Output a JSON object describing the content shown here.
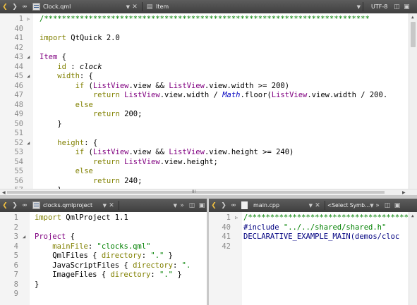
{
  "top_toolbar": {
    "file_name": "Clock.qml",
    "symbol": "Item",
    "encoding": "UTF-8"
  },
  "top_editor": {
    "lines": [
      {
        "n": "1",
        "fold": "▷",
        "tokens": [
          {
            "t": "/*************************************************************************",
            "c": "cmt"
          }
        ]
      },
      {
        "n": "40",
        "fold": "",
        "tokens": []
      },
      {
        "n": "41",
        "fold": "",
        "tokens": [
          {
            "t": "import ",
            "c": "kw"
          },
          {
            "t": "QtQuick 2.0",
            "c": ""
          }
        ]
      },
      {
        "n": "42",
        "fold": "",
        "tokens": []
      },
      {
        "n": "43",
        "fold": "◢",
        "tokens": [
          {
            "t": "Item",
            "c": "type"
          },
          {
            "t": " {",
            "c": ""
          }
        ]
      },
      {
        "n": "44",
        "fold": "",
        "tokens": [
          {
            "t": "    ",
            "c": ""
          },
          {
            "t": "id",
            "c": "kw"
          },
          {
            "t": " : ",
            "c": ""
          },
          {
            "t": "clock",
            "c": "italic"
          }
        ]
      },
      {
        "n": "45",
        "fold": "◢",
        "tokens": [
          {
            "t": "    ",
            "c": ""
          },
          {
            "t": "width",
            "c": "kw"
          },
          {
            "t": ": {",
            "c": ""
          }
        ]
      },
      {
        "n": "46",
        "fold": "",
        "tokens": [
          {
            "t": "        ",
            "c": ""
          },
          {
            "t": "if",
            "c": "kw"
          },
          {
            "t": " (",
            "c": ""
          },
          {
            "t": "ListView",
            "c": "type"
          },
          {
            "t": ".view && ",
            "c": ""
          },
          {
            "t": "ListView",
            "c": "type"
          },
          {
            "t": ".view.width >= 200)",
            "c": ""
          }
        ]
      },
      {
        "n": "47",
        "fold": "",
        "tokens": [
          {
            "t": "            ",
            "c": ""
          },
          {
            "t": "return",
            "c": "kw"
          },
          {
            "t": " ",
            "c": ""
          },
          {
            "t": "ListView",
            "c": "type"
          },
          {
            "t": ".view.width / ",
            "c": ""
          },
          {
            "t": "Math",
            "c": "blue-it"
          },
          {
            "t": ".floor(",
            "c": ""
          },
          {
            "t": "ListView",
            "c": "type"
          },
          {
            "t": ".view.width / 200.",
            "c": ""
          }
        ]
      },
      {
        "n": "48",
        "fold": "",
        "tokens": [
          {
            "t": "        ",
            "c": ""
          },
          {
            "t": "else",
            "c": "kw"
          }
        ]
      },
      {
        "n": "49",
        "fold": "",
        "tokens": [
          {
            "t": "            ",
            "c": ""
          },
          {
            "t": "return",
            "c": "kw"
          },
          {
            "t": " 200;",
            "c": ""
          }
        ]
      },
      {
        "n": "50",
        "fold": "",
        "tokens": [
          {
            "t": "    }",
            "c": ""
          }
        ]
      },
      {
        "n": "51",
        "fold": "",
        "tokens": []
      },
      {
        "n": "52",
        "fold": "◢",
        "tokens": [
          {
            "t": "    ",
            "c": ""
          },
          {
            "t": "height",
            "c": "kw"
          },
          {
            "t": ": {",
            "c": ""
          }
        ]
      },
      {
        "n": "53",
        "fold": "",
        "tokens": [
          {
            "t": "        ",
            "c": ""
          },
          {
            "t": "if",
            "c": "kw"
          },
          {
            "t": " (",
            "c": ""
          },
          {
            "t": "ListView",
            "c": "type"
          },
          {
            "t": ".view && ",
            "c": ""
          },
          {
            "t": "ListView",
            "c": "type"
          },
          {
            "t": ".view.height >= 240)",
            "c": ""
          }
        ]
      },
      {
        "n": "54",
        "fold": "",
        "tokens": [
          {
            "t": "            ",
            "c": ""
          },
          {
            "t": "return",
            "c": "kw"
          },
          {
            "t": " ",
            "c": ""
          },
          {
            "t": "ListView",
            "c": "type"
          },
          {
            "t": ".view.height;",
            "c": ""
          }
        ]
      },
      {
        "n": "55",
        "fold": "",
        "tokens": [
          {
            "t": "        ",
            "c": ""
          },
          {
            "t": "else",
            "c": "kw"
          }
        ]
      },
      {
        "n": "56",
        "fold": "",
        "tokens": [
          {
            "t": "            ",
            "c": ""
          },
          {
            "t": "return",
            "c": "kw"
          },
          {
            "t": " 240;",
            "c": ""
          }
        ]
      },
      {
        "n": "57",
        "fold": "",
        "tokens": [
          {
            "t": "    }",
            "c": ""
          }
        ]
      }
    ],
    "hscroll_grip": "III"
  },
  "bottom_left_toolbar": {
    "file_name": "clocks.qmlproject"
  },
  "bottom_left_editor": {
    "lines": [
      {
        "n": "1",
        "fold": "",
        "tokens": [
          {
            "t": "import ",
            "c": "kw"
          },
          {
            "t": "QmlProject 1.1",
            "c": ""
          }
        ]
      },
      {
        "n": "2",
        "fold": "",
        "tokens": []
      },
      {
        "n": "3",
        "fold": "◢",
        "tokens": [
          {
            "t": "Project",
            "c": "type"
          },
          {
            "t": " {",
            "c": ""
          }
        ]
      },
      {
        "n": "4",
        "fold": "",
        "tokens": [
          {
            "t": "    ",
            "c": ""
          },
          {
            "t": "mainFile",
            "c": "kw"
          },
          {
            "t": ": ",
            "c": ""
          },
          {
            "t": "\"clocks.qml\"",
            "c": "str"
          }
        ]
      },
      {
        "n": "5",
        "fold": "",
        "tokens": [
          {
            "t": "    QmlFiles { ",
            "c": ""
          },
          {
            "t": "directory",
            "c": "kw"
          },
          {
            "t": ": ",
            "c": ""
          },
          {
            "t": "\".\"",
            "c": "str"
          },
          {
            "t": " }",
            "c": ""
          }
        ]
      },
      {
        "n": "6",
        "fold": "",
        "tokens": [
          {
            "t": "    JavaScriptFiles { ",
            "c": ""
          },
          {
            "t": "directory",
            "c": "kw"
          },
          {
            "t": ": ",
            "c": ""
          },
          {
            "t": "\".",
            "c": "str"
          }
        ]
      },
      {
        "n": "7",
        "fold": "",
        "tokens": [
          {
            "t": "    ImageFiles { ",
            "c": ""
          },
          {
            "t": "directory",
            "c": "kw"
          },
          {
            "t": ": ",
            "c": ""
          },
          {
            "t": "\".\"",
            "c": "str"
          },
          {
            "t": " }",
            "c": ""
          }
        ]
      },
      {
        "n": "8",
        "fold": "",
        "tokens": [
          {
            "t": "}",
            "c": ""
          }
        ]
      },
      {
        "n": "9",
        "fold": "",
        "tokens": []
      }
    ]
  },
  "bottom_right_toolbar": {
    "file_name": "main.cpp",
    "symbol": "<Select Symb..."
  },
  "bottom_right_editor": {
    "lines": [
      {
        "n": "1",
        "fold": "▷",
        "tokens": [
          {
            "t": "/*****************************************",
            "c": "cmt"
          }
        ]
      },
      {
        "n": "40",
        "fold": "",
        "tokens": [
          {
            "t": "#include ",
            "c": "macro"
          },
          {
            "t": "\"../../shared/shared.h\"",
            "c": "str"
          }
        ]
      },
      {
        "n": "41",
        "fold": "",
        "tokens": [
          {
            "t": "DECLARATIVE_EXAMPLE_MAIN(demos/cloc",
            "c": "macro"
          }
        ]
      },
      {
        "n": "42",
        "fold": "",
        "tokens": []
      }
    ]
  },
  "colors": {
    "toolbar_bg": "#4a4a4a",
    "keyword": "#808000",
    "type": "#800080",
    "string": "#008000",
    "comment": "#008000"
  }
}
